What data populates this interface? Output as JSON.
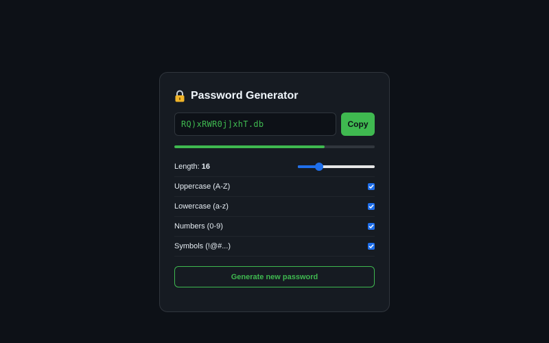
{
  "app": {
    "title": "Password Generator",
    "icon": "lock-icon"
  },
  "password": {
    "value": "RQ)xRWR0j]xhT.db",
    "strength_fraction": 0.75
  },
  "copy_button": {
    "label": "Copy"
  },
  "length": {
    "label": "Length:",
    "value": "16",
    "slider_fraction": 0.28
  },
  "options": [
    {
      "label": "Uppercase (A-Z)",
      "checked": true
    },
    {
      "label": "Lowercase (a-z)",
      "checked": true
    },
    {
      "label": "Numbers (0-9)",
      "checked": true
    },
    {
      "label": "Symbols (!@#...)",
      "checked": true
    }
  ],
  "generate_button": {
    "label": "Generate new password"
  },
  "colors": {
    "accent": "#3fb950",
    "checkbox": "#1f6feb",
    "background": "#0d1117",
    "card": "#161b22"
  }
}
